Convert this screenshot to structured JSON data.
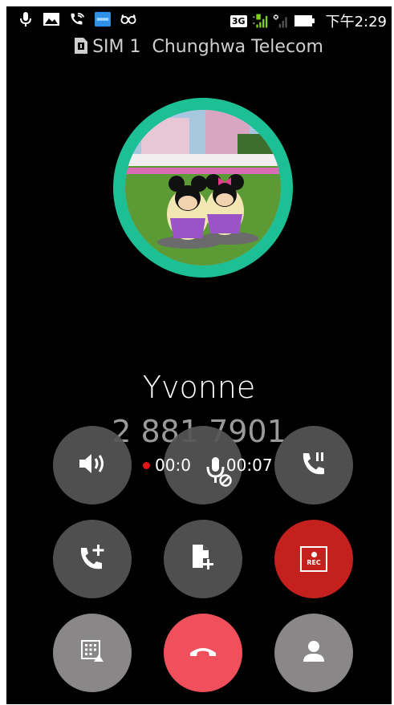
{
  "status_bar": {
    "network_badge": "3G",
    "time": "下午2:29",
    "icons": [
      "microphone-icon",
      "image-icon",
      "wifi-call-icon",
      "asus-icon",
      "glasses-icon",
      "signal-icon",
      "no-sim-signal-icon",
      "battery-icon"
    ]
  },
  "sim": {
    "label": "SIM 1",
    "carrier": "Chunghwa Telecom"
  },
  "caller": {
    "name": "Yvonne",
    "number": "2 881 7901"
  },
  "call": {
    "timer_left": "00:0",
    "timer_right": "00:07",
    "rec_label": "REC"
  },
  "colors": {
    "accent": "#1dbf94",
    "rec": "#c4201e",
    "end_call": "#f0505b",
    "button": "#555555"
  }
}
